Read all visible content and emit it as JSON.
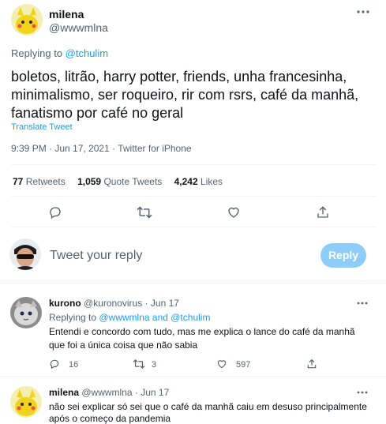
{
  "main_tweet": {
    "display_name": "milena",
    "handle": "@wwwmlna",
    "replying_prefix": "Replying to ",
    "replying_to": "@tchulim",
    "text_line1": "boletos, litrão, harry potter, friends, unha francesinha,",
    "text_line2": "minimalismo, ser roqueiro, rir com rsrs, café da manhã,",
    "text_line3": "fanatismo por café no geral",
    "translate": "Translate Tweet",
    "timestamp": "9:39 PM · Jun 17, 2021 · Twitter for iPhone",
    "stats": {
      "retweets_num": "77",
      "retweets_label": "Retweets",
      "quotes_num": "1,059",
      "quotes_label": "Quote Tweets",
      "likes_num": "4,242",
      "likes_label": "Likes"
    }
  },
  "compose": {
    "placeholder": "Tweet your reply",
    "reply_button": "Reply"
  },
  "replies": [
    {
      "display_name": "kurono",
      "handle_time": "@kuronovirus · Jun 17",
      "replying_prefix": "Replying to ",
      "replying_to": "@wwwmlna and @tchulim",
      "text_line1": "Entendi e concordo com tudo, mas me explica o lance do café da manhã",
      "text_line2": "que foi a única coisa que não sabia",
      "replies_count": "16",
      "retweets_count": "3",
      "likes_count": "597"
    },
    {
      "display_name": "milena",
      "handle_time": "@wwwmlna · Jun 17",
      "text_line1": "não sei explicar só sei que o café da manhã caiu em desuso principalmente",
      "text_line2": "após o começo da pandemia"
    }
  ],
  "colors": {
    "accent": "#1d9bf0",
    "reply_button": "#8ecdf8",
    "text": "#0f1419",
    "muted": "#536471",
    "divider": "#eff3f4"
  },
  "icons": {
    "more": "more-horizontal-icon",
    "reply": "reply-icon",
    "retweet": "retweet-icon",
    "like": "heart-icon",
    "share": "share-icon"
  }
}
